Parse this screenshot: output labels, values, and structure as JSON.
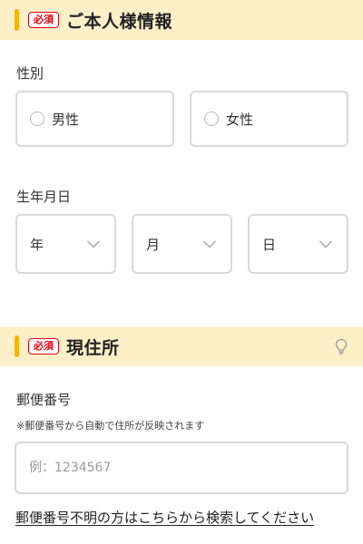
{
  "personal_section": {
    "required_badge": "必須",
    "title": "ご本人様情報"
  },
  "gender": {
    "label": "性別",
    "options": [
      "男性",
      "女性"
    ]
  },
  "birthdate": {
    "label": "生年月日",
    "year": "年",
    "month": "月",
    "day": "日"
  },
  "address_section": {
    "required_badge": "必須",
    "title": "現住所",
    "hint_icon": "lightbulb-icon"
  },
  "postal": {
    "label": "郵便番号",
    "note": "※郵便番号から自動で住所が反映されます",
    "placeholder": "例：1234567",
    "value": "",
    "help_link": "郵便番号不明の方はこちらから検索してください"
  },
  "colors": {
    "header_bg": "#fdf0c8",
    "accent_bar": "#f7b500",
    "required_red": "#e60012",
    "border": "#d9d9d9"
  }
}
